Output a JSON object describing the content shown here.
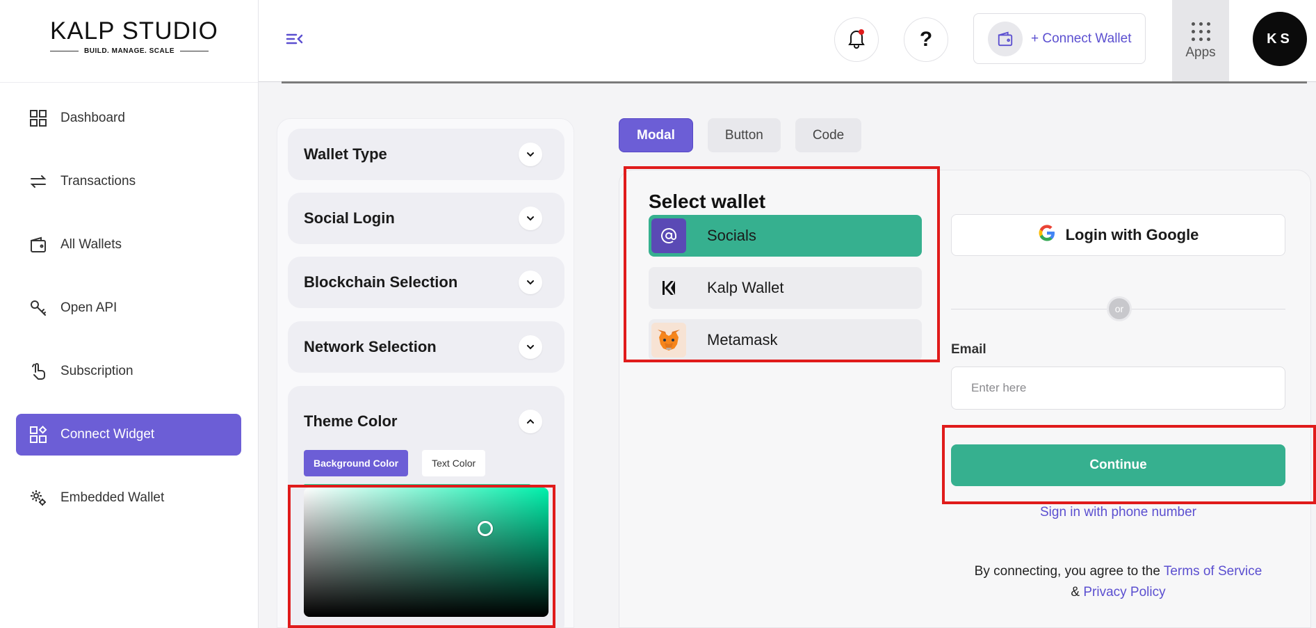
{
  "brand": {
    "logo_main": "KALP STUDIO",
    "logo_tagline": "BUILD. MANAGE. SCALE"
  },
  "sidebar": {
    "items": [
      {
        "label": "Dashboard",
        "icon": "dashboard-grid-icon",
        "active": false
      },
      {
        "label": "Transactions",
        "icon": "transfer-arrows-icon",
        "active": false
      },
      {
        "label": "All Wallets",
        "icon": "wallet-icon",
        "active": false
      },
      {
        "label": "Open API",
        "icon": "key-icon",
        "active": false
      },
      {
        "label": "Subscription",
        "icon": "tap-hand-icon",
        "active": false
      },
      {
        "label": "Connect Widget",
        "icon": "widget-grid-icon",
        "active": true
      },
      {
        "label": "Embedded Wallet",
        "icon": "gears-icon",
        "active": false
      }
    ]
  },
  "header": {
    "connect_wallet_label": "+ Connect Wallet",
    "help_glyph": "?",
    "apps_label": "Apps",
    "avatar_initials": "KS"
  },
  "config": {
    "sections": [
      {
        "label": "Wallet Type",
        "expanded": false
      },
      {
        "label": "Social Login",
        "expanded": false
      },
      {
        "label": "Blockchain Selection",
        "expanded": false
      },
      {
        "label": "Network Selection",
        "expanded": false
      }
    ],
    "theme": {
      "label": "Theme Color",
      "expanded": true,
      "tabs": [
        {
          "label": "Background Color",
          "active": true
        },
        {
          "label": "Text Color",
          "active": false
        }
      ],
      "selected_hue": "#00f0ab"
    }
  },
  "preview": {
    "tabs": [
      {
        "label": "Modal",
        "active": true
      },
      {
        "label": "Button",
        "active": false
      },
      {
        "label": "Code",
        "active": false
      }
    ],
    "select_wallet_title": "Select wallet",
    "wallets": [
      {
        "label": "Socials",
        "selected": true
      },
      {
        "label": "Kalp Wallet",
        "selected": false
      },
      {
        "label": "Metamask",
        "selected": false
      }
    ],
    "google_label": "Login with Google",
    "or_label": "or",
    "email_label": "Email",
    "email_placeholder": "Enter here",
    "email_value": "",
    "continue_label": "Continue",
    "phone_link": "Sign in with phone number",
    "terms_prefix": "By connecting, you agree to the",
    "terms_link": "Terms of Service",
    "terms_amp": "&",
    "privacy_link": "Privacy Policy"
  },
  "colors": {
    "accent": "#6c5ed6",
    "theme_green": "#36b08f",
    "highlight_red": "#e01b1b"
  }
}
